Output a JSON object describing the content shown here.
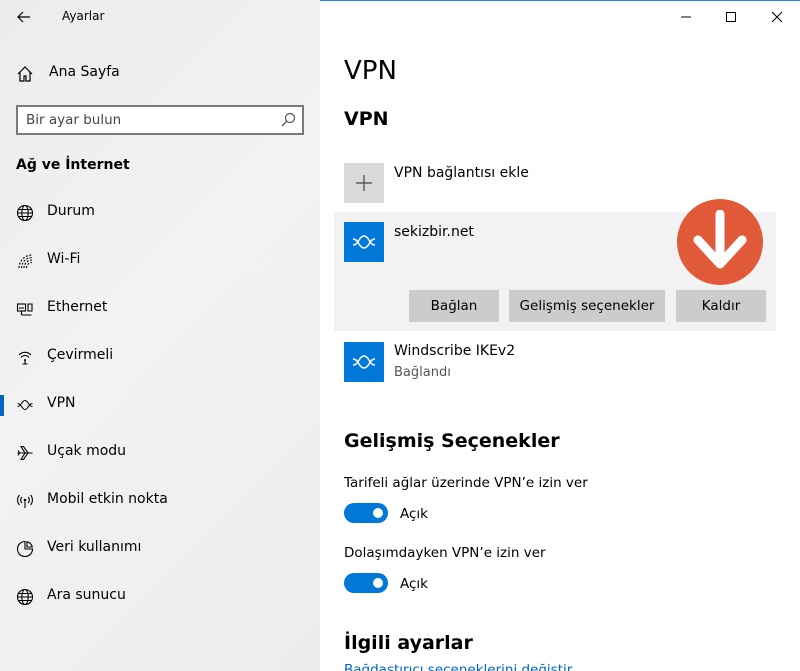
{
  "window": {
    "title": "Ayarlar"
  },
  "sidebar": {
    "home_label": "Ana Sayfa",
    "search_placeholder": "Bir ayar bulun",
    "section_title": "Ağ ve İnternet",
    "items": [
      {
        "label": "Durum",
        "icon": "globe-icon"
      },
      {
        "label": "Wi-Fi",
        "icon": "wifi-icon"
      },
      {
        "label": "Ethernet",
        "icon": "ethernet-icon"
      },
      {
        "label": "Çevirmeli",
        "icon": "dialup-icon"
      },
      {
        "label": "VPN",
        "icon": "vpn-icon",
        "active": true
      },
      {
        "label": "Uçak modu",
        "icon": "airplane-icon"
      },
      {
        "label": "Mobil etkin nokta",
        "icon": "hotspot-icon"
      },
      {
        "label": "Veri kullanımı",
        "icon": "data-usage-icon"
      },
      {
        "label": "Ara sunucu",
        "icon": "proxy-globe-icon"
      }
    ]
  },
  "main": {
    "page_title": "VPN",
    "vpn_section_title": "VPN",
    "add_label": "VPN bağlantısı ekle",
    "connections": [
      {
        "name": "sekizbir.net",
        "status": ""
      },
      {
        "name": "Windscribe IKEv2",
        "status": "Bağlandı"
      }
    ],
    "buttons": {
      "connect": "Bağlan",
      "advanced": "Gelişmiş seçenekler",
      "remove": "Kaldır"
    },
    "advanced_title": "Gelişmiş Seçenekler",
    "options": [
      {
        "label": "Tarifeli ağlar üzerinde VPN’e izin ver",
        "state": "Açık",
        "on": true
      },
      {
        "label": "Dolaşımdayken VPN’e izin ver",
        "state": "Açık",
        "on": true
      }
    ],
    "related_title": "İlgili ayarlar",
    "related_link": "Bağdaştırıcı seçeneklerini değiştir"
  },
  "colors": {
    "accent": "#0078d7",
    "annotation": "#e05a39",
    "sidebar_bg": "#f0f0f0"
  }
}
